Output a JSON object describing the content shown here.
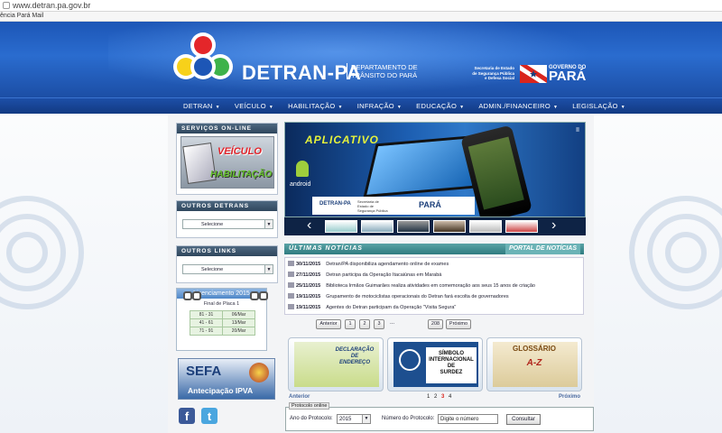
{
  "browser": {
    "url": "www.detran.pa.gov.br",
    "favorites": "ência Pará Mail"
  },
  "header": {
    "brand": "DETRAN-PA",
    "dept_line1": "DEPARTAMENTO DE",
    "dept_line2": "TRÂNSITO DO PARÁ",
    "secretaria_1": "Secretaria de Estado",
    "secretaria_2": "de Segurança Pública",
    "secretaria_3": "e Defesa Social",
    "gov_small": "GOVERNO DO",
    "gov_big": "PARÁ"
  },
  "nav": {
    "items": [
      {
        "label": "DETRAN"
      },
      {
        "label": "VEÍCULO"
      },
      {
        "label": "HABILITAÇÃO"
      },
      {
        "label": "INFRAÇÃO"
      },
      {
        "label": "EDUCAÇÃO"
      },
      {
        "label": "ADMIN./FINANCEIRO"
      },
      {
        "label": "LEGISLAÇÃO"
      }
    ]
  },
  "sidebar": {
    "servicos_title": "SERVIÇOS ON-LINE",
    "servicos_veiculo": "VEÍCULO",
    "servicos_habilitacao": "HABILITAÇÃO",
    "outros_detrans_title": "OUTROS DETRANS",
    "outros_detrans_value": "Selecione",
    "outros_links_title": "OUTROS LINKS",
    "outros_links_value": "Selecione",
    "licenciamento_title": "Licenciamento 2015",
    "licenciamento_sub": "Final de Placa 1",
    "licenciamento_rows": [
      {
        "range": "81 - 31",
        "date": "06/Mar"
      },
      {
        "range": "41 - 61",
        "date": "13/Mar"
      },
      {
        "range": "71 - 91",
        "date": "20/Mar"
      }
    ],
    "sefa_title": "SEFA",
    "sefa_sub": "Antecipação IPVA",
    "facebook": "f",
    "twitter": "t"
  },
  "banner": {
    "title": "APLICATIVO",
    "platform": "android",
    "footer_detran": "DETRAN-PA",
    "footer_sec_1": "Secretaria de",
    "footer_sec_2": "Estado de",
    "footer_sec_3": "Segurança Pública",
    "footer_gov": "PARÁ",
    "pause": "II"
  },
  "news": {
    "title": "ÚLTIMAS NOTÍCIAS",
    "portal": "PORTAL DE NOTÍCIAS",
    "items": [
      {
        "date": "30/11/2015",
        "text": "Detran/PA disponibiliza agendamento online de exames"
      },
      {
        "date": "27/11/2015",
        "text": "Detran participa da Operação Itacaiúnas em Marabá"
      },
      {
        "date": "25/11/2015",
        "text": "Biblioteca Irmãos Guimarães realiza atividades em comemoração aos seus 15 anos de criação"
      },
      {
        "date": "19/11/2015",
        "text": "Grupamento de motociclistas operacionais do Detran fará escolta de governadores"
      },
      {
        "date": "19/11/2015",
        "text": "Agentes do Detran participam da Operação \"Visita Segura\""
      }
    ],
    "pager": {
      "prev": "Anterior",
      "p1": "1",
      "p2": "2",
      "p3": "3",
      "ellipsis": "...",
      "last": "208",
      "next": "Próximo"
    }
  },
  "cards": {
    "c1_line1": "DECLARAÇÃO",
    "c1_line2": "DE",
    "c1_line3": "ENDEREÇO",
    "c2_line1": "SÍMBOLO",
    "c2_line2": "INTERNACIONAL",
    "c2_line3": "DE",
    "c2_line4": "SURDEZ",
    "c3_line1": "GLOSSÁRIO",
    "c3_line2": "A-Z",
    "nav_prev": "Anterior",
    "nav_next": "Próximo",
    "pages": [
      "1",
      "2",
      "3",
      "4"
    ]
  },
  "protocolo": {
    "legend": "Protocolo online",
    "ano_label": "Ano do Protocolo:",
    "ano_value": "2015",
    "numero_label": "Número do Protocolo:",
    "numero_value": "Digite o número",
    "consultar": "Consultar"
  },
  "colors": {
    "header_blue": "#1d56b6",
    "nav_blue": "#123a82",
    "news_teal": "#2f7b80",
    "current_page": "#d9251d"
  }
}
